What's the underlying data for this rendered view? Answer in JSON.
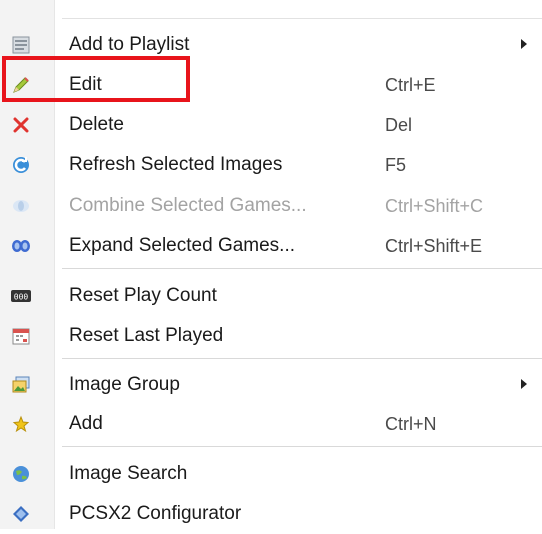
{
  "menu": {
    "items": [
      {
        "label": "Add to Playlist",
        "shortcut": "",
        "icon": "playlist-icon"
      },
      {
        "label": "Edit",
        "shortcut": "Ctrl+E",
        "icon": "pencil-icon"
      },
      {
        "label": "Delete",
        "shortcut": "Del",
        "icon": "delete-x-icon"
      },
      {
        "label": "Refresh Selected Images",
        "shortcut": "F5",
        "icon": "refresh-icon"
      },
      {
        "label": "Combine Selected Games...",
        "shortcut": "Ctrl+Shift+C",
        "icon": "combine-icon"
      },
      {
        "label": "Expand Selected Games...",
        "shortcut": "Ctrl+Shift+E",
        "icon": "expand-icon"
      },
      {
        "label": "Reset Play Count",
        "shortcut": "",
        "icon": "counter-icon"
      },
      {
        "label": "Reset Last Played",
        "shortcut": "",
        "icon": "calendar-icon"
      },
      {
        "label": "Image Group",
        "shortcut": "",
        "icon": "image-group-icon"
      },
      {
        "label": "Add",
        "shortcut": "Ctrl+N",
        "icon": "add-star-icon"
      },
      {
        "label": "Image Search",
        "shortcut": "",
        "icon": "globe-search-icon"
      },
      {
        "label": "PCSX2 Configurator",
        "shortcut": "",
        "icon": "configurator-icon"
      }
    ]
  },
  "colors": {
    "highlight_border": "#e8141b",
    "disabled_text": "#a3a3a3",
    "strip_background": "#f3f3f3"
  }
}
